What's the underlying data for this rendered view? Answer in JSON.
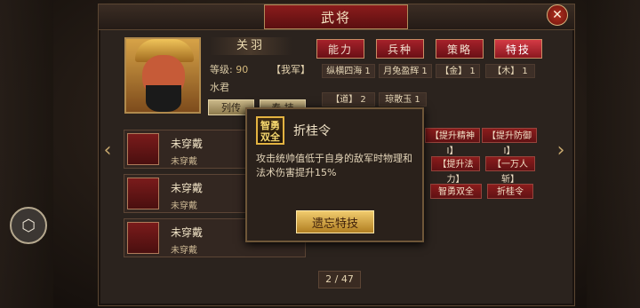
{
  "window": {
    "title": "武将",
    "close_label": "✕"
  },
  "general": {
    "name": "关羽",
    "level_label": "等级:",
    "level_value": "90",
    "faction": "【我军】",
    "title": "水君",
    "btn_bio": "列传",
    "btn_other": "奉 技"
  },
  "tabs": [
    {
      "label": "能力",
      "active": false
    },
    {
      "label": "兵种",
      "active": false
    },
    {
      "label": "策略",
      "active": false
    },
    {
      "label": "特技",
      "active": true
    }
  ],
  "skills": {
    "row1": [
      "纵横四海 1",
      "月兔盈辉 1",
      "【金】 1",
      "【木】 1"
    ],
    "row2": [
      "【道】 2",
      "琼散玉 1"
    ],
    "row3": [
      "【提升精神 I】",
      "【提升防御 I】"
    ],
    "row4": [
      "【提升法力】",
      "【一万人斩】"
    ],
    "row5": [
      "智勇双全",
      "折桂令"
    ]
  },
  "equipment": [
    {
      "name": "未穿戴",
      "sub": "未穿戴"
    },
    {
      "name": "未穿戴",
      "sub": "未穿戴"
    },
    {
      "name": "未穿戴",
      "sub": "未穿戴"
    }
  ],
  "popup": {
    "badge": "智勇双全",
    "title": "折桂令",
    "description": "攻击统帅值低于自身的敌军时物理和法术伤害提升15%",
    "button": "遗忘特技"
  },
  "pager": "2 / 47",
  "colors": {
    "accent_red": "#8b1c1c",
    "gold": "#e3b341"
  }
}
